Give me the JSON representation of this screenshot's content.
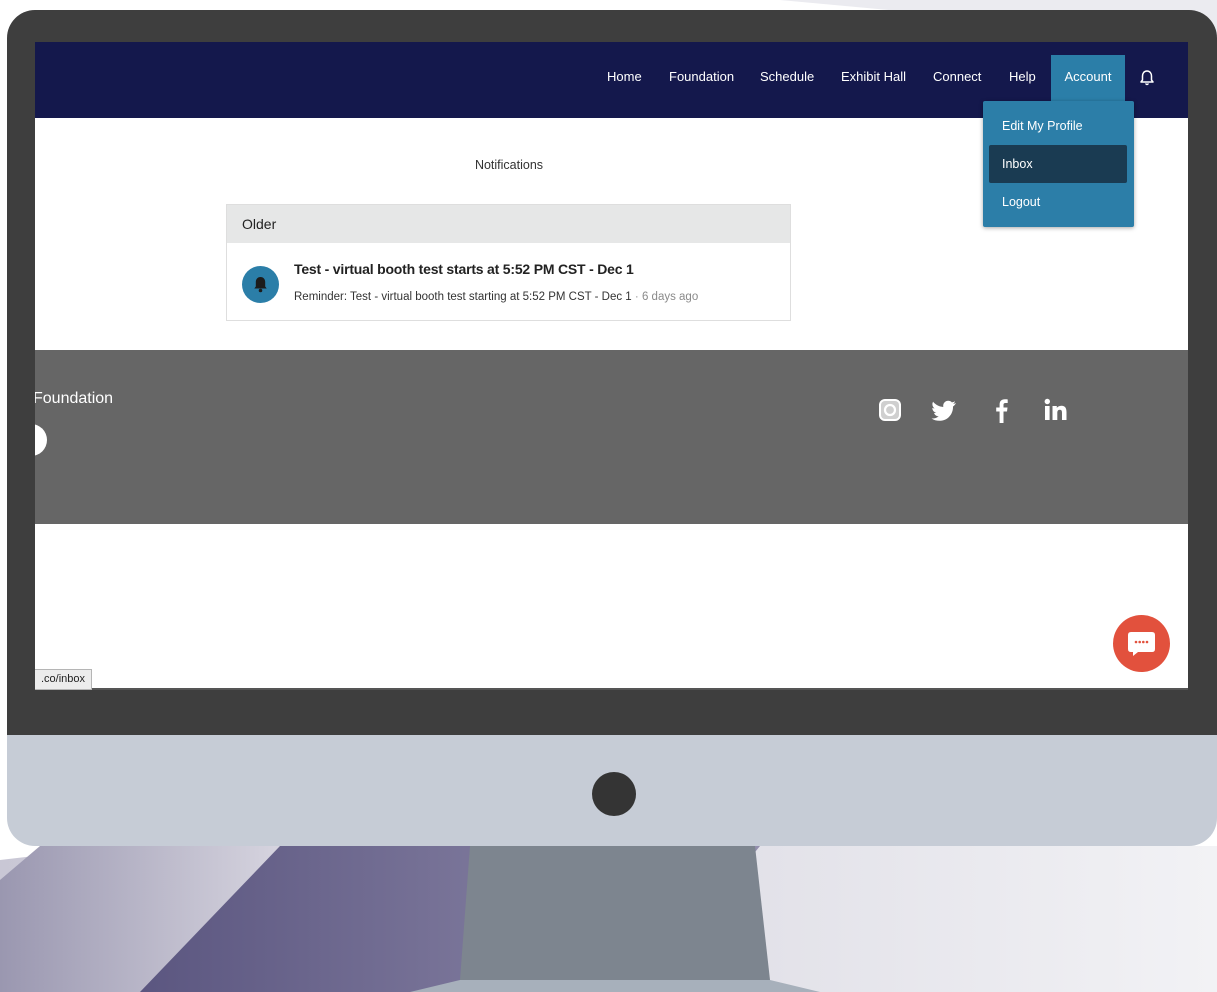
{
  "nav": {
    "links": [
      "Home",
      "Foundation",
      "Schedule",
      "Exhibit Hall",
      "Connect",
      "Help"
    ],
    "account": "Account"
  },
  "dropdown": {
    "items": [
      "Edit My Profile",
      "Inbox",
      "Logout"
    ],
    "active": "Inbox"
  },
  "page": {
    "heading": "Notifications"
  },
  "notifications": {
    "section": "Older",
    "items": [
      {
        "title": "Test - virtual booth test starts at 5:52 PM CST - Dec 1",
        "body": "Reminder: Test - virtual booth test starting at 5:52 PM CST - Dec 1",
        "separator": "·",
        "time": "6 days ago"
      }
    ]
  },
  "footer": {
    "title": "Foundation",
    "social": [
      "instagram-icon",
      "twitter-icon",
      "facebook-icon",
      "linkedin-icon"
    ]
  },
  "status_bar": {
    "url": ".co/inbox"
  },
  "colors": {
    "navbar": "#14184c",
    "accent": "#2b7ea8",
    "dropdown_active": "#1a3b52",
    "footer": "#666666",
    "chat": "#e2513d"
  }
}
